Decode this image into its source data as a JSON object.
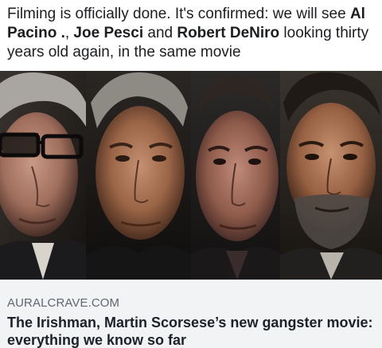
{
  "post": {
    "text_parts": [
      "Filming is officially done. It's confirmed: we will see ",
      "Al Pacino .",
      ", ",
      "Joe Pesci",
      " and ",
      "Robert DeNiro",
      " looking thirty years old again, in the same movie"
    ]
  },
  "photo": {
    "portraits": [
      "portrait-glasses-man",
      "portrait-gray-haired-man",
      "portrait-short-haired-man",
      "portrait-bearded-man"
    ]
  },
  "link_card": {
    "domain": "AURALCRAVE.COM",
    "title": "The Irishman, Martin Scorsese’s new gangster movie: everything we know so far"
  },
  "colors": {
    "text": "#1c1e21",
    "domain": "#606770",
    "card_bg": "#f2f3f5"
  }
}
